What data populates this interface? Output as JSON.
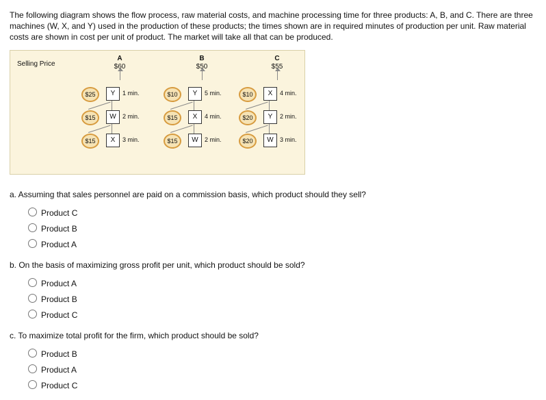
{
  "intro": "The following diagram shows the flow process, raw material costs, and machine processing time for three products: A, B, and C. There are three machines (W, X, and Y) used in the production of these products; the times shown are in required minutes of production per unit. Raw material costs are shown in cost per unit of product. The market will take all that can be produced.",
  "selling_price_label": "Selling Price",
  "products": {
    "A": {
      "label": "A",
      "price": "$60",
      "steps": [
        {
          "cost": "$25",
          "machine": "Y",
          "time": "1 min."
        },
        {
          "cost": "$15",
          "machine": "W",
          "time": "2 min."
        },
        {
          "cost": "$15",
          "machine": "X",
          "time": "3 min."
        }
      ]
    },
    "B": {
      "label": "B",
      "price": "$50",
      "steps": [
        {
          "cost": "$10",
          "machine": "Y",
          "time": "5 min."
        },
        {
          "cost": "$15",
          "machine": "X",
          "time": "4 min."
        },
        {
          "cost": "$15",
          "machine": "W",
          "time": "2 min."
        }
      ]
    },
    "C": {
      "label": "C",
      "price": "$55",
      "steps": [
        {
          "cost": "$10",
          "machine": "X",
          "time": "4 min."
        },
        {
          "cost": "$20",
          "machine": "Y",
          "time": "2 min."
        },
        {
          "cost": "$20",
          "machine": "W",
          "time": "3 min."
        }
      ]
    }
  },
  "questions": {
    "a": {
      "text": "a. Assuming that sales personnel are paid on a commission basis, which product should they sell?",
      "options": [
        "Product C",
        "Product B",
        "Product A"
      ]
    },
    "b": {
      "text": "b. On the basis of maximizing gross profit per unit, which product should be sold?",
      "options": [
        "Product A",
        "Product B",
        "Product C"
      ]
    },
    "c": {
      "text": "c. To maximize total profit for the firm, which product should be sold?",
      "options": [
        "Product B",
        "Product A",
        "Product C"
      ]
    }
  }
}
